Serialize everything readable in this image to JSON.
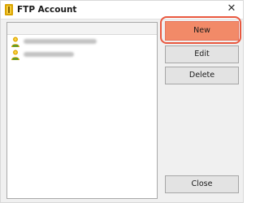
{
  "window": {
    "title": "FTP Account",
    "close_glyph": "✕",
    "icon": "ftp-app-icon"
  },
  "list": {
    "rows": [
      {
        "icon": "user-icon",
        "label_blurred": true
      },
      {
        "icon": "user-icon",
        "label_blurred": true
      }
    ]
  },
  "buttons": {
    "new": "New",
    "edit": "Edit",
    "delete": "Delete",
    "close": "Close"
  },
  "colors": {
    "new_button_fill": "#f28a68",
    "highlight_ring": "#e9583f",
    "icon_gold": "#e0a800"
  }
}
